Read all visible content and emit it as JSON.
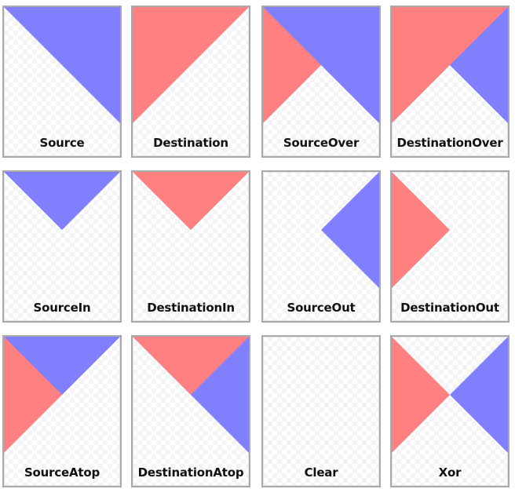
{
  "colors": {
    "source": "#8080ff",
    "destination": "#ff8080"
  },
  "tiles": [
    {
      "label": "Source"
    },
    {
      "label": "Destination"
    },
    {
      "label": "SourceOver"
    },
    {
      "label": "DestinationOver"
    },
    {
      "label": "SourceIn"
    },
    {
      "label": "DestinationIn"
    },
    {
      "label": "SourceOut"
    },
    {
      "label": "DestinationOut"
    },
    {
      "label": "SourceAtop"
    },
    {
      "label": "DestinationAtop"
    },
    {
      "label": "Clear"
    },
    {
      "label": "Xor"
    }
  ]
}
